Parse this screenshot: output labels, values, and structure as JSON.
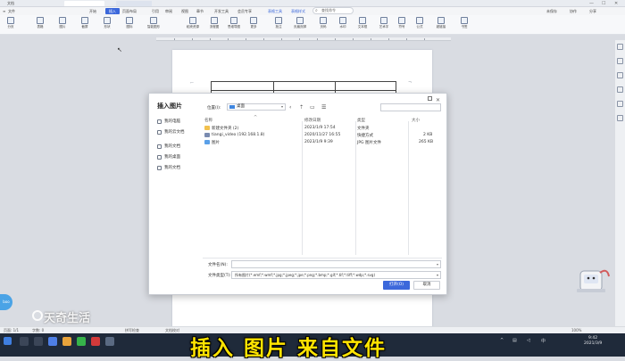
{
  "tabbar": {
    "tabs": [
      "文档",
      "",
      "",
      ""
    ],
    "window_controls": [
      "□",
      "—",
      "☐",
      "✕"
    ]
  },
  "menu": {
    "file": "文件",
    "items": [
      "开始",
      "插入",
      "页面布局",
      "引用",
      "审阅",
      "视图",
      "章节",
      "开发工具",
      "会员专享",
      "表格工具",
      "表格样式"
    ],
    "active_index": 1,
    "search": "查找命令",
    "right": [
      "未保存",
      "协作",
      "分享"
    ]
  },
  "ribbon": {
    "items": [
      "分页",
      "表格",
      "图片",
      "截屏",
      "形状",
      "图标",
      "智能图形",
      "稻壳资源",
      "流程图",
      "思维导图",
      "更多",
      "批注",
      "页眉页脚",
      "页码",
      "水印",
      "文本框",
      "艺术字",
      "符号",
      "公式",
      "超链接",
      "书签"
    ]
  },
  "dialog": {
    "title": "插入图片",
    "location_label": "位置(I):",
    "location_value": "桌面",
    "nav": [
      "我的电脑",
      "我的云文档",
      "我的文档",
      "我的桌面",
      "我的文档"
    ],
    "columns": [
      "名称",
      "修改日期",
      "类型",
      "大小"
    ],
    "files": [
      {
        "name": "新建文件夹 (2)",
        "date": "2023/1/9 17:54",
        "type": "文件夹",
        "size": "",
        "icon": "folder-icon",
        "color": "#f2c14e"
      },
      {
        "name": "tiangi_video (192.168.1.8)",
        "date": "2020/11/27 16:55",
        "type": "快捷方式",
        "size": "2 KB",
        "icon": "shortcut-icon",
        "color": "#7a8bb0"
      },
      {
        "name": "图片",
        "date": "2023/1/9 9:39",
        "type": "JPG 图片文件",
        "size": "265 KB",
        "icon": "image-file-icon",
        "color": "#5aa0e8"
      }
    ],
    "filename_label": "文件名(N):",
    "filetype_label": "文件类型(T):",
    "filetype_value": "所有图片(*.emf;*.wmf;*.jpg;*.jpeg;*.jpe;*.png;*.bmp;*.gif;*.tif;*.tiff;*.wdp;*.svg)",
    "open_button": "打开(O)",
    "cancel_button": "取消"
  },
  "statusbar": {
    "items": [
      "页面: 1/1",
      "字数: 0",
      "拼写检查",
      "文档校对"
    ],
    "zoom": "100%"
  },
  "taskbar": {
    "time": "9:42",
    "date": "2021/3/9"
  },
  "overlay": {
    "subtitle": "插入 图片 来自文件",
    "watermark": "天奇生活",
    "bubble": "boo"
  },
  "colors": {
    "accent": "#3c68db",
    "subtitle": "#ffe400",
    "taskbar": "#1f2a3a"
  }
}
